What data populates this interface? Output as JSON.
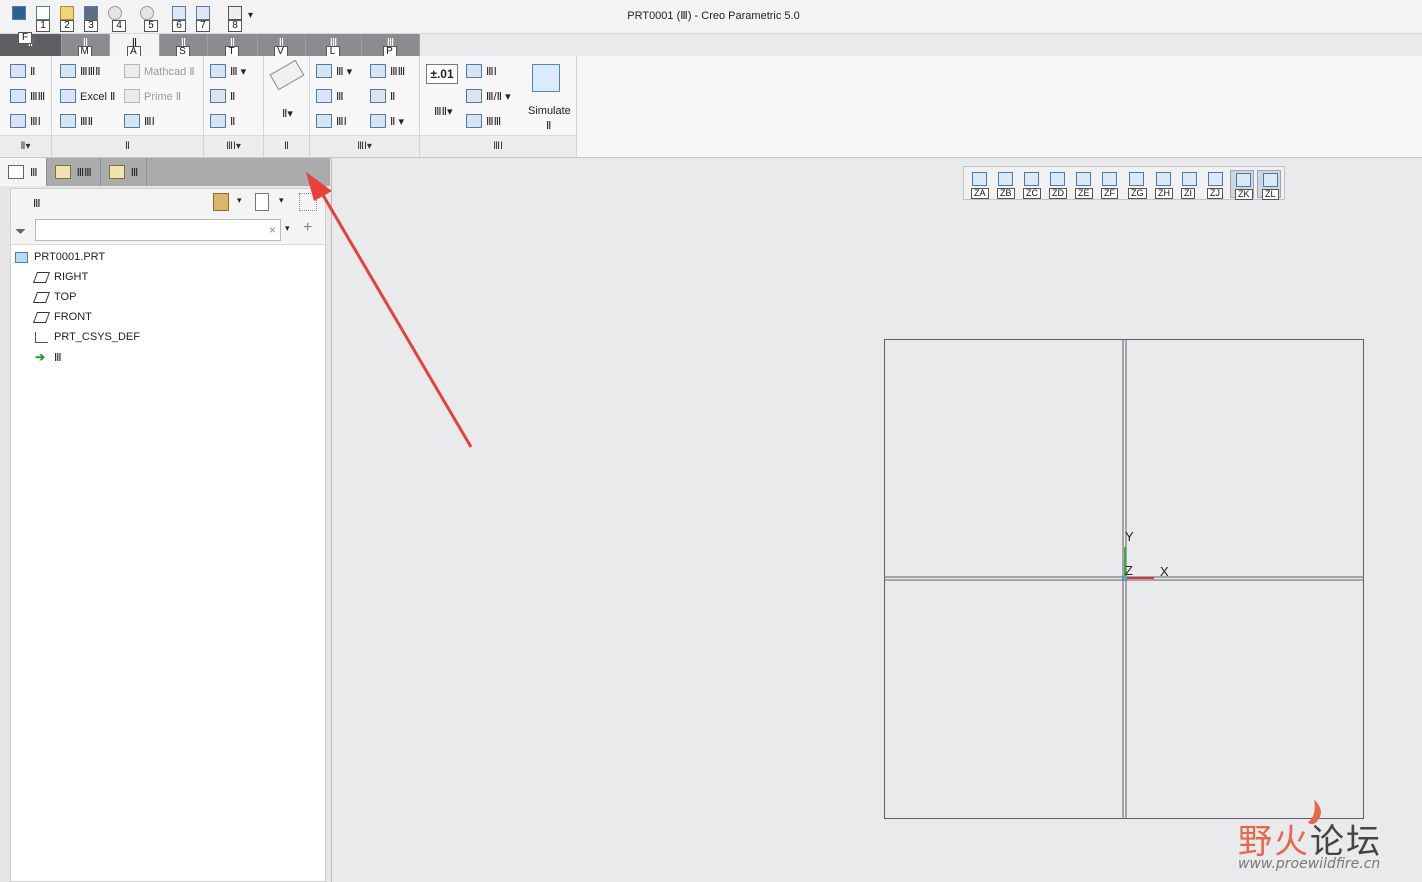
{
  "window": {
    "title": "PRT0001 (Ⅲ) - Creo Parametric 5.0"
  },
  "quick_access": {
    "buttons": [
      {
        "name": "window-icon",
        "key": ""
      },
      {
        "name": "new-icon",
        "key": "1"
      },
      {
        "name": "open-icon",
        "key": "2"
      },
      {
        "name": "save-icon",
        "key": "3"
      },
      {
        "name": "undo-icon",
        "key": "4"
      },
      {
        "name": "redo-icon",
        "key": "5"
      },
      {
        "name": "regenerate-icon",
        "key": "6"
      },
      {
        "name": "windows-icon",
        "key": "7"
      },
      {
        "name": "close-icon",
        "key": "8"
      }
    ]
  },
  "ribbon": {
    "tabs": [
      {
        "label": "Ⅱ",
        "key": "F"
      },
      {
        "label": "Ⅱ",
        "key": "M"
      },
      {
        "label": "Ⅱ",
        "key": "A"
      },
      {
        "label": "Ⅱ",
        "key": "S"
      },
      {
        "label": "Ⅱ",
        "key": "T"
      },
      {
        "label": "Ⅱ",
        "key": "V"
      },
      {
        "label": "Ⅲ",
        "key": "L"
      },
      {
        "label": "Ⅲ",
        "key": "P"
      }
    ],
    "groups": {
      "g1": {
        "label": "Ⅱ▾",
        "items": [
          "Ⅱ",
          "ⅢⅢ",
          "ⅢⅠ"
        ]
      },
      "g2": {
        "label": "Ⅱ",
        "items": [
          "ⅢⅢⅡ",
          "Excel Ⅱ",
          "ⅢⅡ",
          "Mathcad Ⅱ",
          "Prime Ⅱ",
          "ⅢⅠ"
        ]
      },
      "g3": {
        "label": "ⅢⅠ▾",
        "items": [
          "Ⅲ ▾",
          "Ⅱ",
          "Ⅱ"
        ]
      },
      "g4": {
        "label": "Ⅱ",
        "items": [
          "Ⅱ▾"
        ]
      },
      "g5": {
        "label": "ⅢⅠ▾",
        "items": [
          "Ⅲ ▾",
          "Ⅲ",
          "ⅢⅠ",
          "ⅢⅢ",
          "Ⅱ",
          "Ⅱ ▾"
        ]
      },
      "g6": {
        "label": "ⅢⅠ",
        "items": [
          "±.01",
          "ⅢⅠ",
          "Ⅲ/Ⅱ ▾",
          "ⅢⅢ",
          "ⅢⅡ▾",
          "Simulate",
          "Ⅱ"
        ]
      }
    }
  },
  "model_tree": {
    "tabs": [
      {
        "label": "Ⅲ",
        "icon": "model-tree-icon"
      },
      {
        "label": "ⅢⅢ",
        "icon": "folder-browser-icon"
      },
      {
        "label": "Ⅲ",
        "icon": "favorites-icon"
      }
    ],
    "toolbar_label": "Ⅲ",
    "filter_placeholder": "",
    "clear": "×",
    "items": [
      {
        "label": "PRT0001.PRT",
        "icon": "part-icon"
      },
      {
        "label": "RIGHT",
        "icon": "datum-plane-icon"
      },
      {
        "label": "TOP",
        "icon": "datum-plane-icon"
      },
      {
        "label": "FRONT",
        "icon": "datum-plane-icon"
      },
      {
        "label": "PRT_CSYS_DEF",
        "icon": "csys-icon"
      },
      {
        "label": "Ⅲ",
        "icon": "insert-here-icon"
      }
    ]
  },
  "view_toolbar": {
    "keys": [
      "ZA",
      "ZB",
      "ZC",
      "ZD",
      "ZE",
      "ZF",
      "ZG",
      "ZH",
      "ZI",
      "ZJ",
      "ZK",
      "ZL"
    ]
  },
  "graphics": {
    "axis_labels": {
      "x": "X",
      "y": "Y",
      "z": "Z"
    }
  },
  "watermark": {
    "cn_a": "野火",
    "cn_b": "论坛",
    "url": "www.proewildfire.cn"
  },
  "colors": {
    "annotation_arrow": "#e8403a",
    "datum_plane": "#6a5a66",
    "csys_x": "#d9383a",
    "csys_y": "#2fae4a",
    "csys_z": "#37b6d9"
  }
}
